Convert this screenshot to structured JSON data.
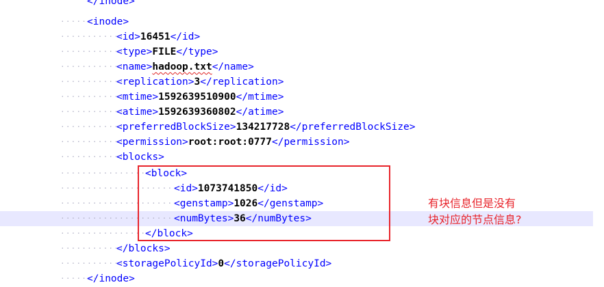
{
  "lines": [
    {
      "indent": "",
      "open": "</inode>",
      "value": "",
      "close": ""
    },
    {
      "indent": "·······",
      "open": "<inode>",
      "value": "",
      "close": ""
    },
    {
      "indent": "············",
      "open": "<id>",
      "value": "16451",
      "close": "</id>"
    },
    {
      "indent": "············",
      "open": "<type>",
      "value": "FILE",
      "close": "</type>"
    },
    {
      "indent": "············",
      "open": "<name>",
      "value": "hadoop.txt",
      "close": "</name>"
    },
    {
      "indent": "············",
      "open": "<replication>",
      "value": "3",
      "close": "</replication>"
    },
    {
      "indent": "············",
      "open": "<mtime>",
      "value": "1592639510900",
      "close": "</mtime>"
    },
    {
      "indent": "············",
      "open": "<atime>",
      "value": "1592639360802",
      "close": "</atime>"
    },
    {
      "indent": "············",
      "open": "<preferredBlockSize>",
      "value": "134217728",
      "close": "</preferredBlockSize>"
    },
    {
      "indent": "············",
      "open": "<permission>",
      "value": "root:root:0777",
      "close": "</permission>"
    },
    {
      "indent": "············",
      "open": "<blocks>",
      "value": "",
      "close": ""
    },
    {
      "indent": "·················",
      "open": "<block>",
      "value": "",
      "close": ""
    },
    {
      "indent": "·······················",
      "open": "<id>",
      "value": "1073741850",
      "close": "</id>"
    },
    {
      "indent": "·······················",
      "open": "<genstamp>",
      "value": "1026",
      "close": "</genstamp>"
    },
    {
      "indent": "·······················",
      "open": "<numBytes>",
      "value": "36",
      "close": "</numBytes>"
    },
    {
      "indent": "·················",
      "open": "</block>",
      "value": "",
      "close": ""
    },
    {
      "indent": "············",
      "open": "</blocks>",
      "value": "",
      "close": ""
    },
    {
      "indent": "············",
      "open": "<storagePolicyId>",
      "value": "0",
      "close": "</storagePolicyId>"
    },
    {
      "indent": "·······",
      "open": "</inode>",
      "value": "",
      "close": ""
    }
  ],
  "annotation": {
    "line1": "有块信息但是没有",
    "line2": "块对应的节点信息?"
  },
  "colors": {
    "tag": "#0000ff",
    "value": "#000000",
    "highlight_line": "#e8e8ff",
    "annotation": "#e8232a",
    "whitespace_marker": "#b4b4c8"
  }
}
